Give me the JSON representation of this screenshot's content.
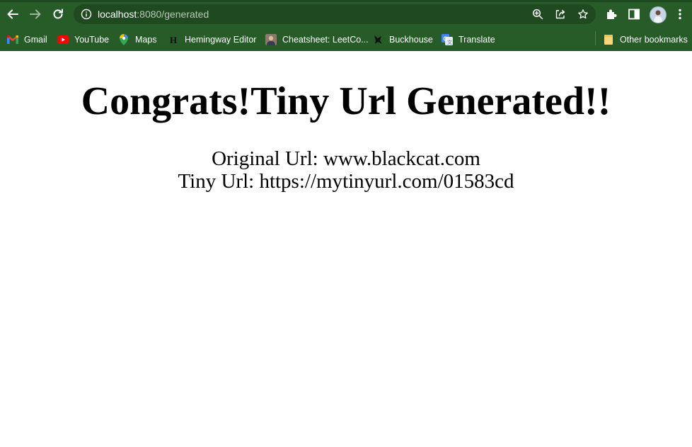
{
  "browser": {
    "url_host": "localhost",
    "url_rest": ":8080/generated"
  },
  "bookmarks": [
    {
      "label": "Gmail",
      "icon": "gmail-icon"
    },
    {
      "label": "YouTube",
      "icon": "youtube-icon"
    },
    {
      "label": "Maps",
      "icon": "maps-icon"
    },
    {
      "label": "Hemingway Editor",
      "icon": "hemingway-icon"
    },
    {
      "label": "Cheatsheet: LeetCo...",
      "icon": "cheatsheet-avatar-icon"
    },
    {
      "label": "Buckhouse",
      "icon": "buckhouse-icon"
    },
    {
      "label": "Translate",
      "icon": "translate-icon"
    }
  ],
  "other_bookmarks": "Other bookmarks",
  "page": {
    "heading": "Congrats!Tiny Url Generated!!",
    "original_label": "Original Url: ",
    "original_url": "www.blackcat.com",
    "tiny_label": "Tiny Url: ",
    "tiny_url": "https://mytinyurl.com/01583cd"
  },
  "colors": {
    "chrome": "#275c28",
    "omnibox": "#1f4a20"
  }
}
